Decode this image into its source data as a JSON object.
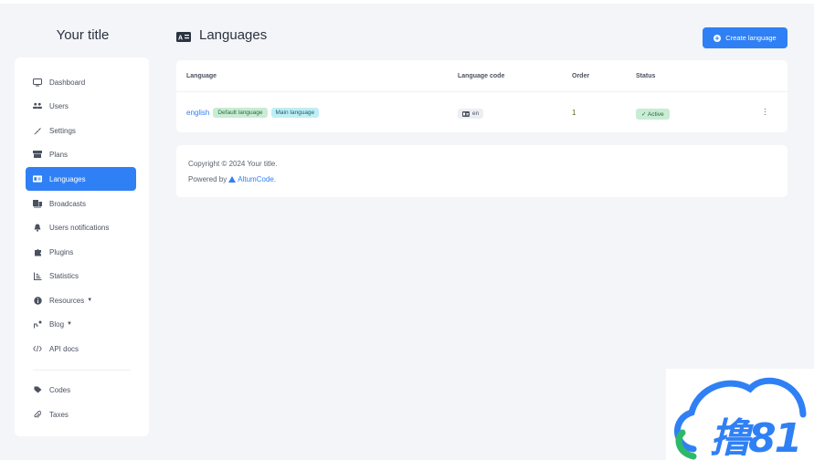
{
  "brand": {
    "title": "Your title"
  },
  "sidebar": {
    "items": [
      {
        "label": "Dashboard",
        "icon": "monitor-icon"
      },
      {
        "label": "Users",
        "icon": "users-icon"
      },
      {
        "label": "Settings",
        "icon": "wrench-icon"
      },
      {
        "label": "Plans",
        "icon": "box-icon"
      },
      {
        "label": "Languages",
        "icon": "language-icon",
        "active": true
      },
      {
        "label": "Broadcasts",
        "icon": "broadcast-icon"
      },
      {
        "label": "Users notifications",
        "icon": "bell-icon"
      },
      {
        "label": "Plugins",
        "icon": "puzzle-icon"
      },
      {
        "label": "Statistics",
        "icon": "chart-icon"
      },
      {
        "label": "Resources",
        "icon": "info-icon",
        "has_dropdown": true
      },
      {
        "label": "Blog",
        "icon": "blog-icon",
        "has_dropdown": true
      },
      {
        "label": "API docs",
        "icon": "code-icon"
      },
      {
        "label": "Codes",
        "icon": "tag-icon"
      },
      {
        "label": "Taxes",
        "icon": "paperclip-icon"
      }
    ]
  },
  "header": {
    "title": "Languages",
    "create_button": "Create language"
  },
  "table": {
    "columns": [
      "Language",
      "Language code",
      "Order",
      "Status"
    ],
    "rows": [
      {
        "language": "english",
        "badges": [
          "Default language",
          "Main language"
        ],
        "code": "en",
        "order": "1",
        "status": "Active"
      }
    ]
  },
  "footer": {
    "copyright": "Copyright © 2024 Your title.",
    "powered_prefix": "Powered by",
    "powered_link": "AltumCode",
    "powered_suffix": "."
  },
  "watermark": {
    "text": "撸81"
  },
  "colors": {
    "accent": "#2f80f5",
    "success_bg": "#c8ecd4",
    "info_bg": "#bfeef4",
    "background": "#f4f5f8"
  }
}
